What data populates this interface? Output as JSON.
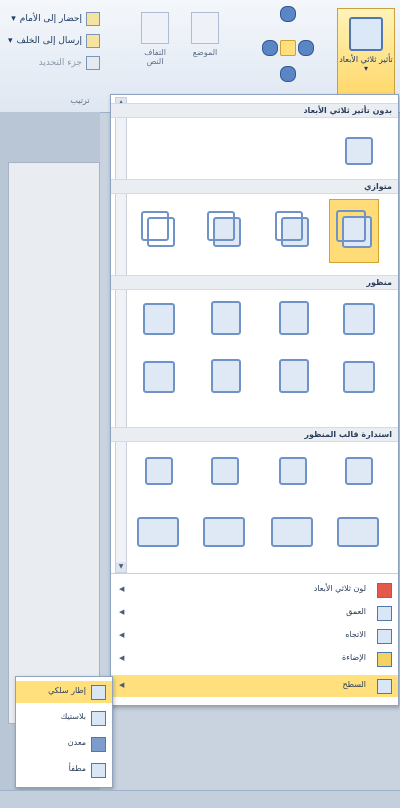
{
  "ribbon": {
    "bring_forward": "إحضار إلى الأمام",
    "send_backward": "إرسال إلى الخلف",
    "selection_pane": "جزء التحديد",
    "btn_position": "الموضع",
    "btn_wrap": "التفاف النص",
    "btn_3d": "تأثير ثلاثي الأبعاد",
    "group_label": "ترتيب"
  },
  "panel": {
    "section_none": "بدون تأثير ثلاثي الأبعاد",
    "section_parallel": "متوازي",
    "section_perspective": "منظور",
    "section_oblique": "استدارة قالب المنظور",
    "menu": [
      {
        "label": "لون ثلاثي الأبعاد",
        "icon": "color-3d-icon"
      },
      {
        "label": "العمق",
        "icon": "depth-icon"
      },
      {
        "label": "الاتجاه",
        "icon": "direction-icon"
      },
      {
        "label": "الإضاءة",
        "icon": "lighting-icon"
      },
      {
        "label": "السطح",
        "icon": "surface-icon"
      }
    ]
  },
  "submenu": {
    "items": [
      {
        "label": "إطار سلكي"
      },
      {
        "label": "بلاستيك"
      },
      {
        "label": "معدن"
      },
      {
        "label": "مطفأ"
      }
    ]
  },
  "colors": {
    "selected": "#ffdc77",
    "accent": "#4f77b3"
  }
}
